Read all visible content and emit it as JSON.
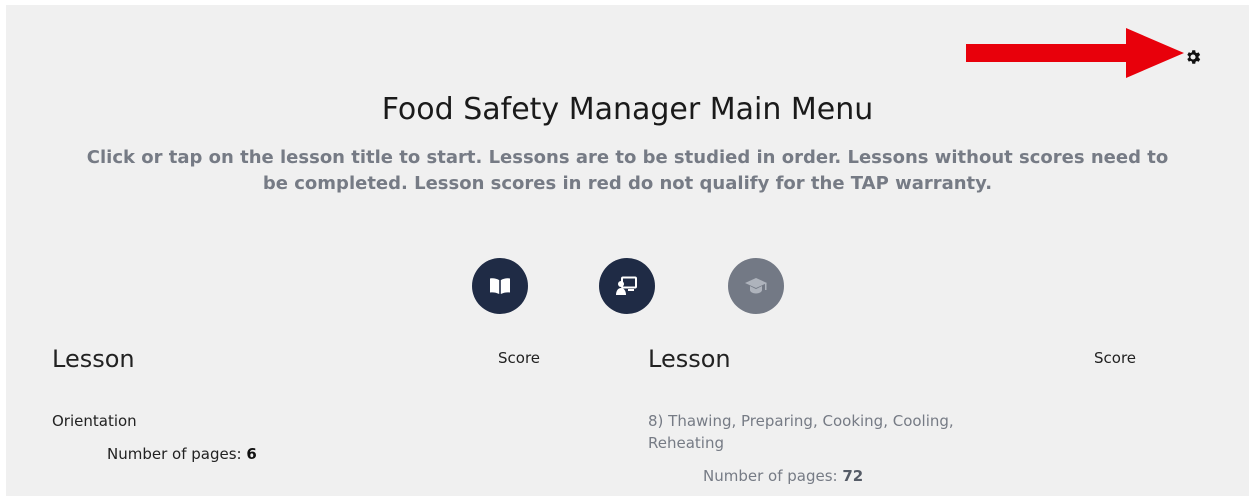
{
  "page": {
    "title": "Food Safety Manager Main Menu",
    "subtitle": "Click or tap on the lesson title to start. Lessons are to be studied in order. Lessons without scores need to be completed. Lesson scores in red do not qualify for the TAP warranty."
  },
  "toolbar": {
    "settings_icon": "gear-icon",
    "annotation_icon": "red-arrow-icon",
    "annotation_color": "#e8000b"
  },
  "mode_buttons": [
    {
      "icon": "book-open-icon",
      "state": "active"
    },
    {
      "icon": "presentation-icon",
      "state": "active"
    },
    {
      "icon": "graduation-cap-icon",
      "state": "disabled"
    }
  ],
  "columns": {
    "left": {
      "lesson_header": "Lesson",
      "score_header": "Score",
      "lessons": [
        {
          "title": "Orientation",
          "pages_label": "Number of pages:",
          "pages": "6"
        }
      ]
    },
    "right": {
      "lesson_header": "Lesson",
      "score_header": "Score",
      "lessons": [
        {
          "title": "8) Thawing, Preparing, Cooking, Cooling, Reheating",
          "pages_label": "Number of pages:",
          "pages": "72"
        }
      ]
    }
  },
  "colors": {
    "panel_bg": "#f0f0f0",
    "button_dark": "#1f2b45",
    "button_muted": "#737985",
    "muted_text": "#767b85"
  }
}
